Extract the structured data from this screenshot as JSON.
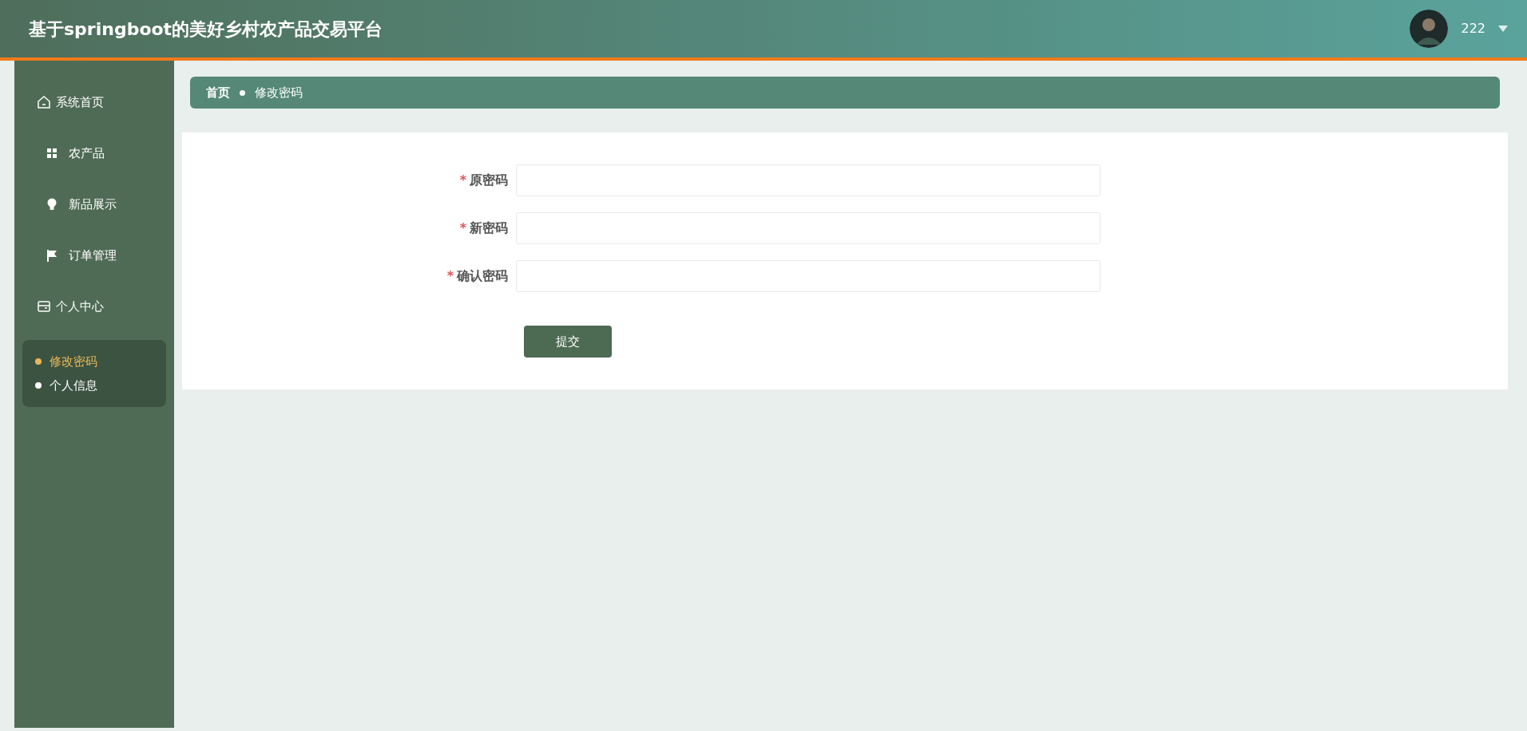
{
  "header": {
    "title": "基于springboot的美好乡村农产品交易平台",
    "user": {
      "name": "222"
    }
  },
  "sidebar": {
    "items": [
      {
        "label": "系统首页"
      },
      {
        "label": "农产品"
      },
      {
        "label": "新品展示"
      },
      {
        "label": "订单管理"
      },
      {
        "label": "个人中心",
        "children": [
          {
            "label": "修改密码",
            "selected": true
          },
          {
            "label": "个人信息",
            "selected": false
          }
        ]
      }
    ]
  },
  "breadcrumb": [
    "首页",
    "修改密码"
  ],
  "form": {
    "fields": [
      {
        "label": "原密码",
        "mark": "*"
      },
      {
        "label": "新密码",
        "mark": "*"
      },
      {
        "label": "确认密码",
        "mark": "*"
      }
    ],
    "submit": "提交"
  }
}
